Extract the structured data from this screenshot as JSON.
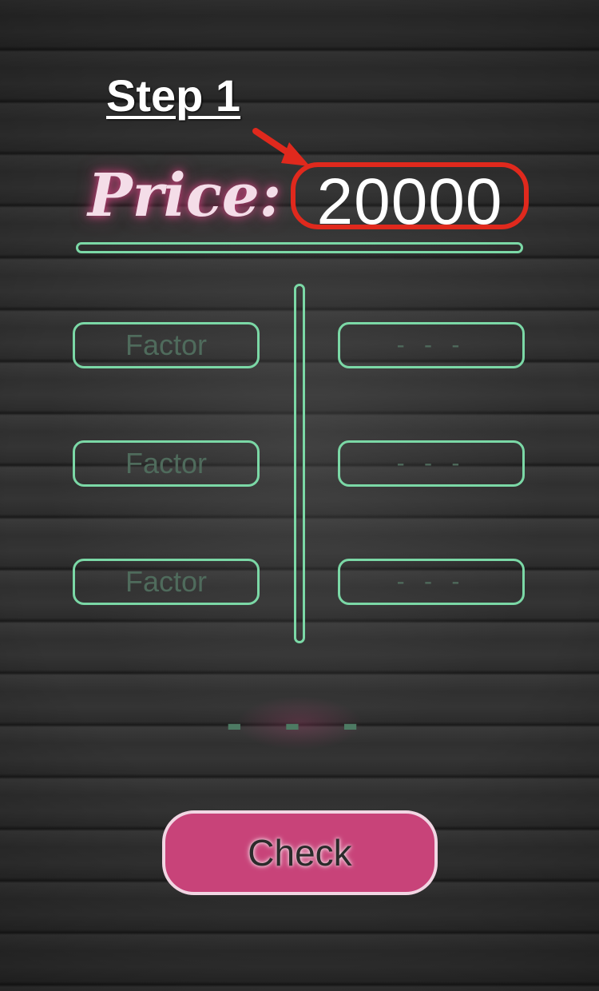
{
  "annotation": {
    "step_label": "Step 1"
  },
  "header": {
    "price_label": "Price:",
    "price_value": "20000"
  },
  "factors": [
    {
      "placeholder": "Factor",
      "result": "- - -"
    },
    {
      "placeholder": "Factor",
      "result": "- - -"
    },
    {
      "placeholder": "Factor",
      "result": "- - -"
    }
  ],
  "total": {
    "value": "- - -"
  },
  "actions": {
    "check_label": "Check"
  },
  "colors": {
    "accent_green": "#7bd8a6",
    "button_pink": "#c84379",
    "highlight_red": "#e0291d",
    "price_glow": "#d64482"
  }
}
